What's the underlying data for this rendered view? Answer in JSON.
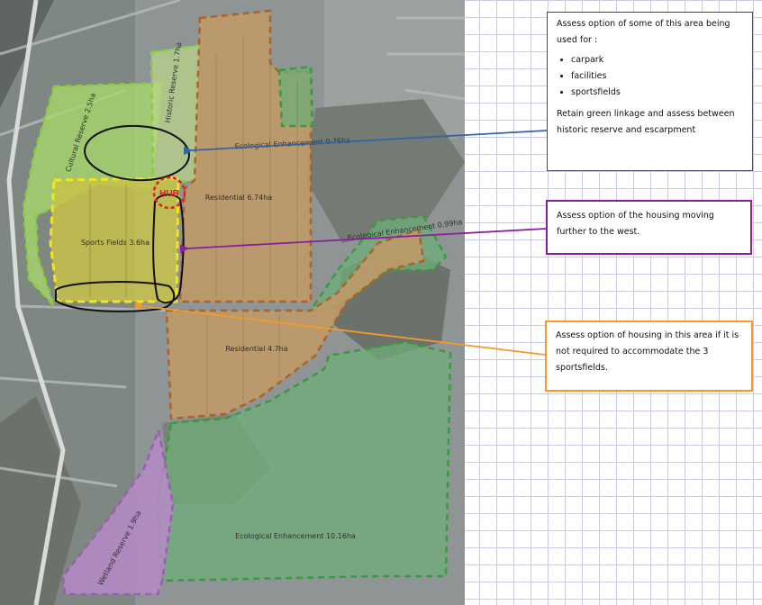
{
  "map": {
    "zones": {
      "historic_reserve": "Historic Reserve 1.7ha",
      "ecological_enhancement_top": "Ecological Enhancement 0.76ha",
      "cultural_reserve": "Cultural Reserve 2.5ha",
      "hub": "HUB",
      "residential_upper": "Residential 6.74ha",
      "sports_fields": "Sports Fields 3.6ha",
      "ecological_right": "Ecological Enhancement 0.99ha",
      "residential_lower": "Residential 4.7ha",
      "ecological_bottom": "Ecological Enhancement 10.16ha",
      "wetland": "Wetland Reserve 1.9ha"
    }
  },
  "notes": {
    "note1": {
      "intro": "Assess option of some of this area being used for :",
      "bullets": [
        "carpark",
        "facilities",
        "sportsfields"
      ],
      "outro": "Retain green linkage and assess between historic reserve and escarpment"
    },
    "note2": {
      "text": "Assess option of the housing moving further to the west."
    },
    "note3": {
      "text": "Assess option of housing in this area if it is not required to accommodate the 3 sportsfields."
    }
  },
  "colors": {
    "blue_arrow": "#3464a4",
    "purple_arrow": "#8a1f9e",
    "orange_arrow": "#f29a2e",
    "hub_ring": "#e02020"
  }
}
